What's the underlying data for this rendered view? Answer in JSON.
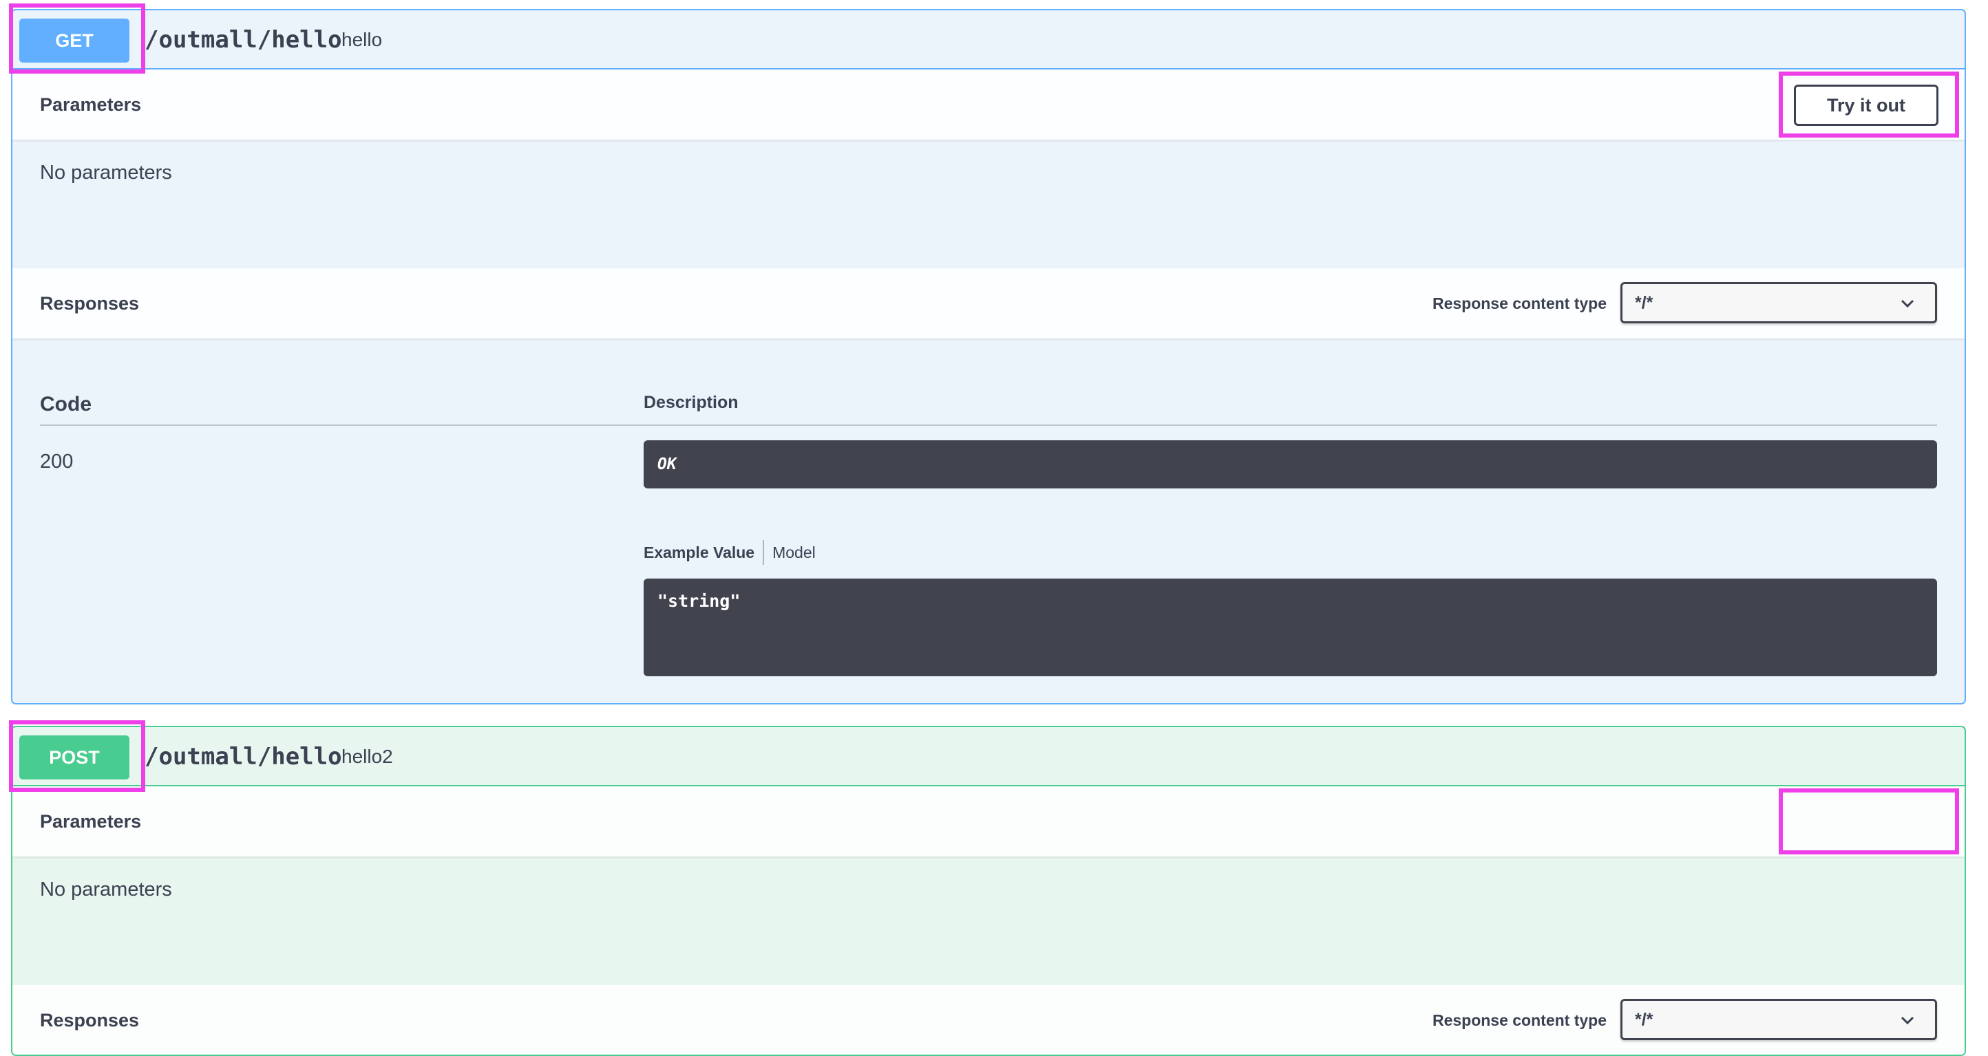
{
  "operations": [
    {
      "method": "GET",
      "path": "/outmall/hello",
      "description": "hello",
      "parameters_title": "Parameters",
      "try_it_out_label": "Try it out",
      "no_parameters_text": "No parameters",
      "responses_title": "Responses",
      "response_content_type_label": "Response content type",
      "response_content_type_value": "*/*",
      "table": {
        "code_header": "Code",
        "description_header": "Description",
        "rows": [
          {
            "code": "200",
            "description": "OK",
            "example_tabs": [
              "Example Value",
              "Model"
            ],
            "example_value": "\"string\""
          }
        ]
      }
    },
    {
      "method": "POST",
      "path": "/outmall/hello",
      "description": "hello2",
      "parameters_title": "Parameters",
      "no_parameters_text": "No parameters",
      "responses_title": "Responses",
      "response_content_type_label": "Response content type",
      "response_content_type_value": "*/*"
    }
  ],
  "colors": {
    "get": "#61affe",
    "post": "#49cc90",
    "get_bg": "#ebf3fb",
    "post_bg": "#e8f6f0",
    "code_block": "#41444e",
    "highlight": "#ee3fe8"
  }
}
